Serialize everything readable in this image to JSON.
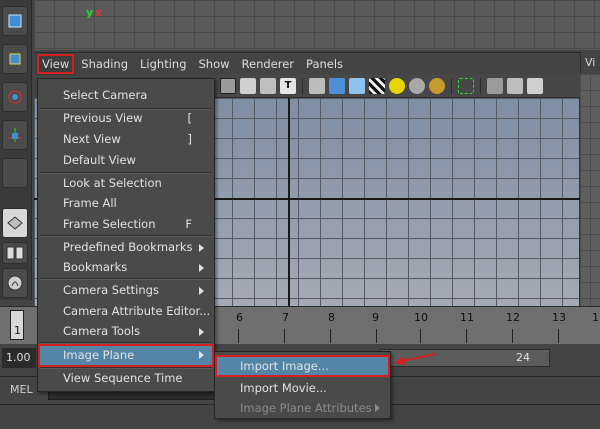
{
  "top_viewport": {
    "axis_y": "y",
    "axis_x": "x"
  },
  "panel_menubar": {
    "items": [
      "View",
      "Shading",
      "Lighting",
      "Show",
      "Renderer",
      "Panels"
    ],
    "right_panel_label": "Vi"
  },
  "view_menu": {
    "items": [
      {
        "label": "Select Camera"
      },
      {
        "label": "Previous View",
        "shortcut": "["
      },
      {
        "label": "Next View",
        "shortcut": "]"
      },
      {
        "label": "Default View"
      },
      {
        "label": "Look at Selection"
      },
      {
        "label": "Frame All"
      },
      {
        "label": "Frame Selection",
        "shortcut": "F"
      },
      {
        "label": "Predefined Bookmarks",
        "submenu": true
      },
      {
        "label": "Bookmarks",
        "submenu": true
      },
      {
        "label": "Camera Settings",
        "submenu": true
      },
      {
        "label": "Camera Attribute Editor..."
      },
      {
        "label": "Camera Tools",
        "submenu": true
      },
      {
        "label": "Image Plane",
        "submenu": true,
        "highlighted": true
      },
      {
        "label": "View Sequence Time"
      }
    ]
  },
  "image_plane_submenu": {
    "items": [
      {
        "label": "Import Image...",
        "highlighted": true
      },
      {
        "label": "Import Movie..."
      },
      {
        "label": "Image Plane Attributes",
        "submenu": true,
        "disabled": true
      }
    ]
  },
  "time_slider": {
    "current_frame": "1",
    "tick_labels": [
      "1",
      "6",
      "7",
      "8",
      "9",
      "10",
      "11",
      "12",
      "13",
      "1"
    ]
  },
  "range_slider": {
    "start_value": "1.00",
    "end_value": "24"
  },
  "command_line": {
    "label": "MEL"
  },
  "colors": {
    "menu_highlight": "#5285a6",
    "annotation_red": "#d42020",
    "viewport_bg": "#8d9aad"
  }
}
